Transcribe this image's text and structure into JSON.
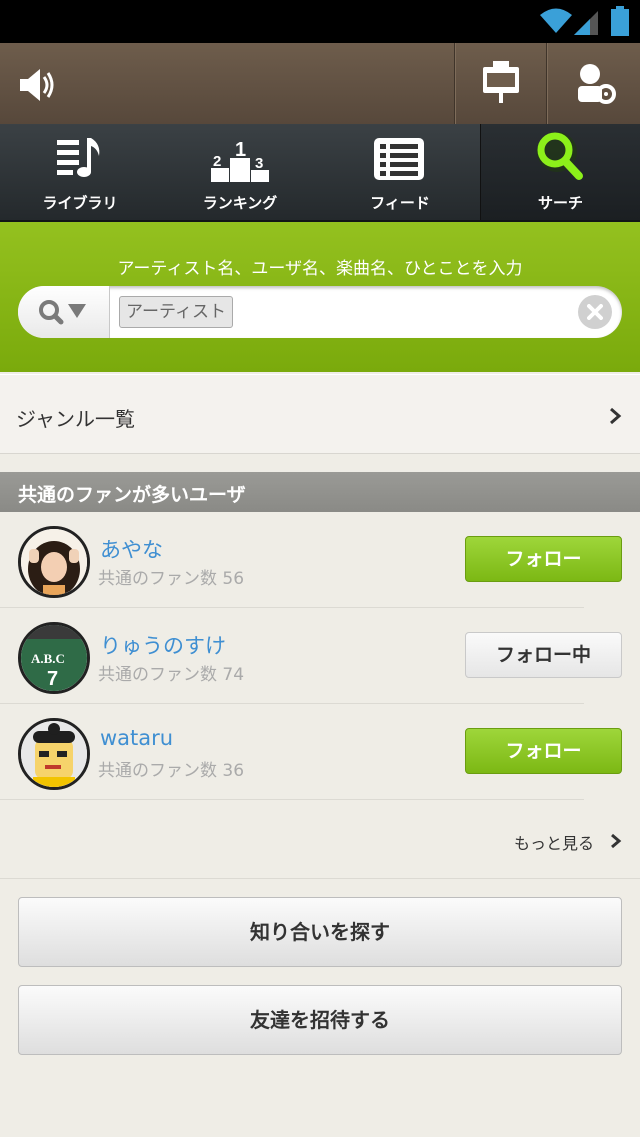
{
  "tabs": [
    {
      "label": "ライブラリ",
      "icon": "music-library-icon"
    },
    {
      "label": "ランキング",
      "icon": "podium-icon"
    },
    {
      "label": "フィード",
      "icon": "feed-list-icon"
    },
    {
      "label": "サーチ",
      "icon": "search-icon",
      "active": true
    }
  ],
  "search": {
    "hint": "アーティスト名、ユーザ名、楽曲名、ひとことを入力",
    "chip": "アーティスト",
    "value": "",
    "placeholder": ""
  },
  "genre": {
    "label": "ジャンル一覧"
  },
  "section": {
    "title": "共通のファンが多いユーザ"
  },
  "users": [
    {
      "name": "あやな",
      "fans": "共通のファン数 56",
      "button": "フォロー",
      "following": false
    },
    {
      "name": "りゅうのすけ",
      "fans": "共通のファン数 74",
      "button": "フォロー中",
      "following": true
    },
    {
      "name": "wataru",
      "fans": "共通のファン数 36",
      "button": "フォロー",
      "following": false
    }
  ],
  "more": "もっと見る",
  "actions": {
    "find_friends": "知り合いを探す",
    "invite_friends": "友達を招待する"
  },
  "colors": {
    "accent_green": "#8cc21a",
    "link_blue": "#3f8fd2",
    "topbar_brown": "#5f4f40"
  }
}
